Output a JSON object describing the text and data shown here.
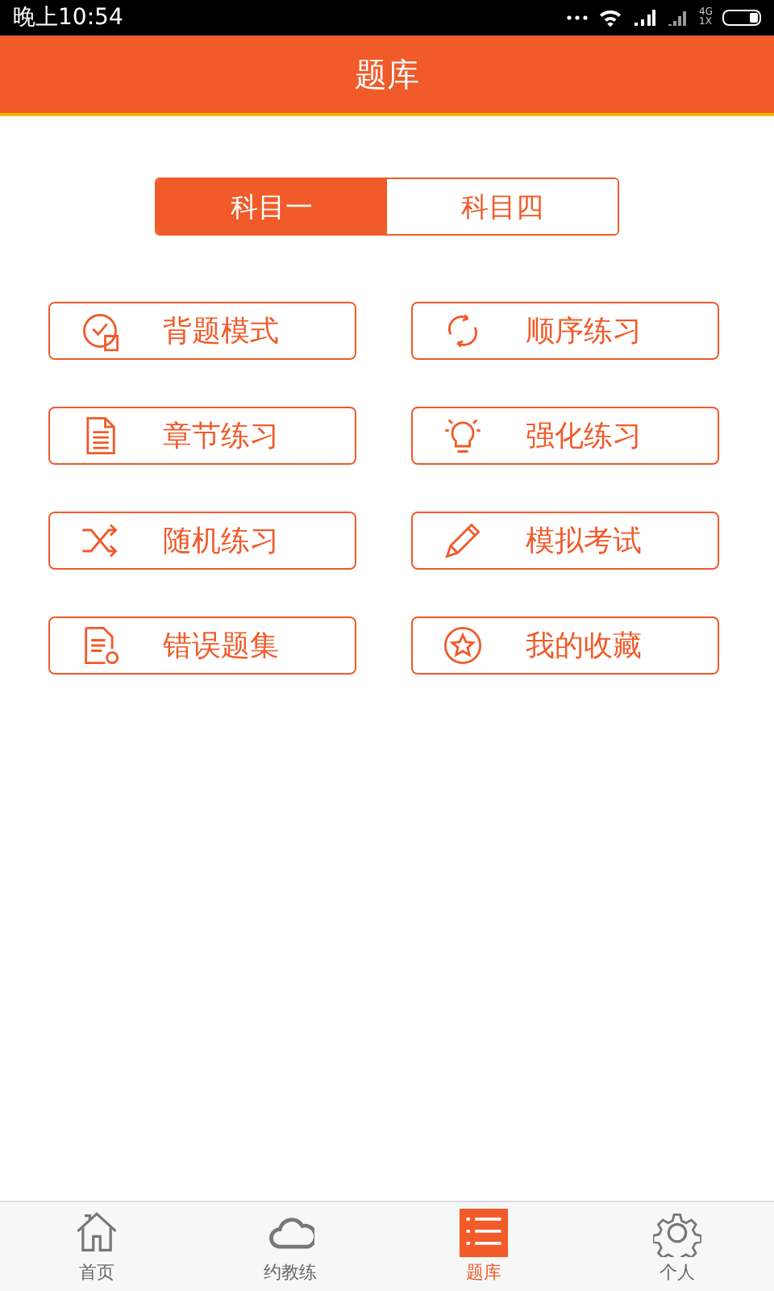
{
  "status_bar": {
    "time": "晚上10:54",
    "network_top": "4G",
    "network_bottom": "1X"
  },
  "header": {
    "title": "题库"
  },
  "segments": [
    {
      "label": "科目一",
      "selected": true
    },
    {
      "label": "科目四",
      "selected": false
    }
  ],
  "buttons": [
    {
      "label": "背题模式",
      "kind": "clock"
    },
    {
      "label": "顺序练习",
      "kind": "cycle"
    },
    {
      "label": "章节练习",
      "kind": "document"
    },
    {
      "label": "强化练习",
      "kind": "bulb"
    },
    {
      "label": "随机练习",
      "kind": "shuffle"
    },
    {
      "label": "模拟考试",
      "kind": "pencil"
    },
    {
      "label": "错误题集",
      "kind": "docgear"
    },
    {
      "label": "我的收藏",
      "kind": "star"
    }
  ],
  "tab_bar": [
    {
      "label": "首页",
      "kind": "home",
      "selected": false
    },
    {
      "label": "约教练",
      "kind": "cloud",
      "selected": false
    },
    {
      "label": "题库",
      "kind": "list",
      "selected": true
    },
    {
      "label": "个人",
      "kind": "gear",
      "selected": false
    }
  ]
}
